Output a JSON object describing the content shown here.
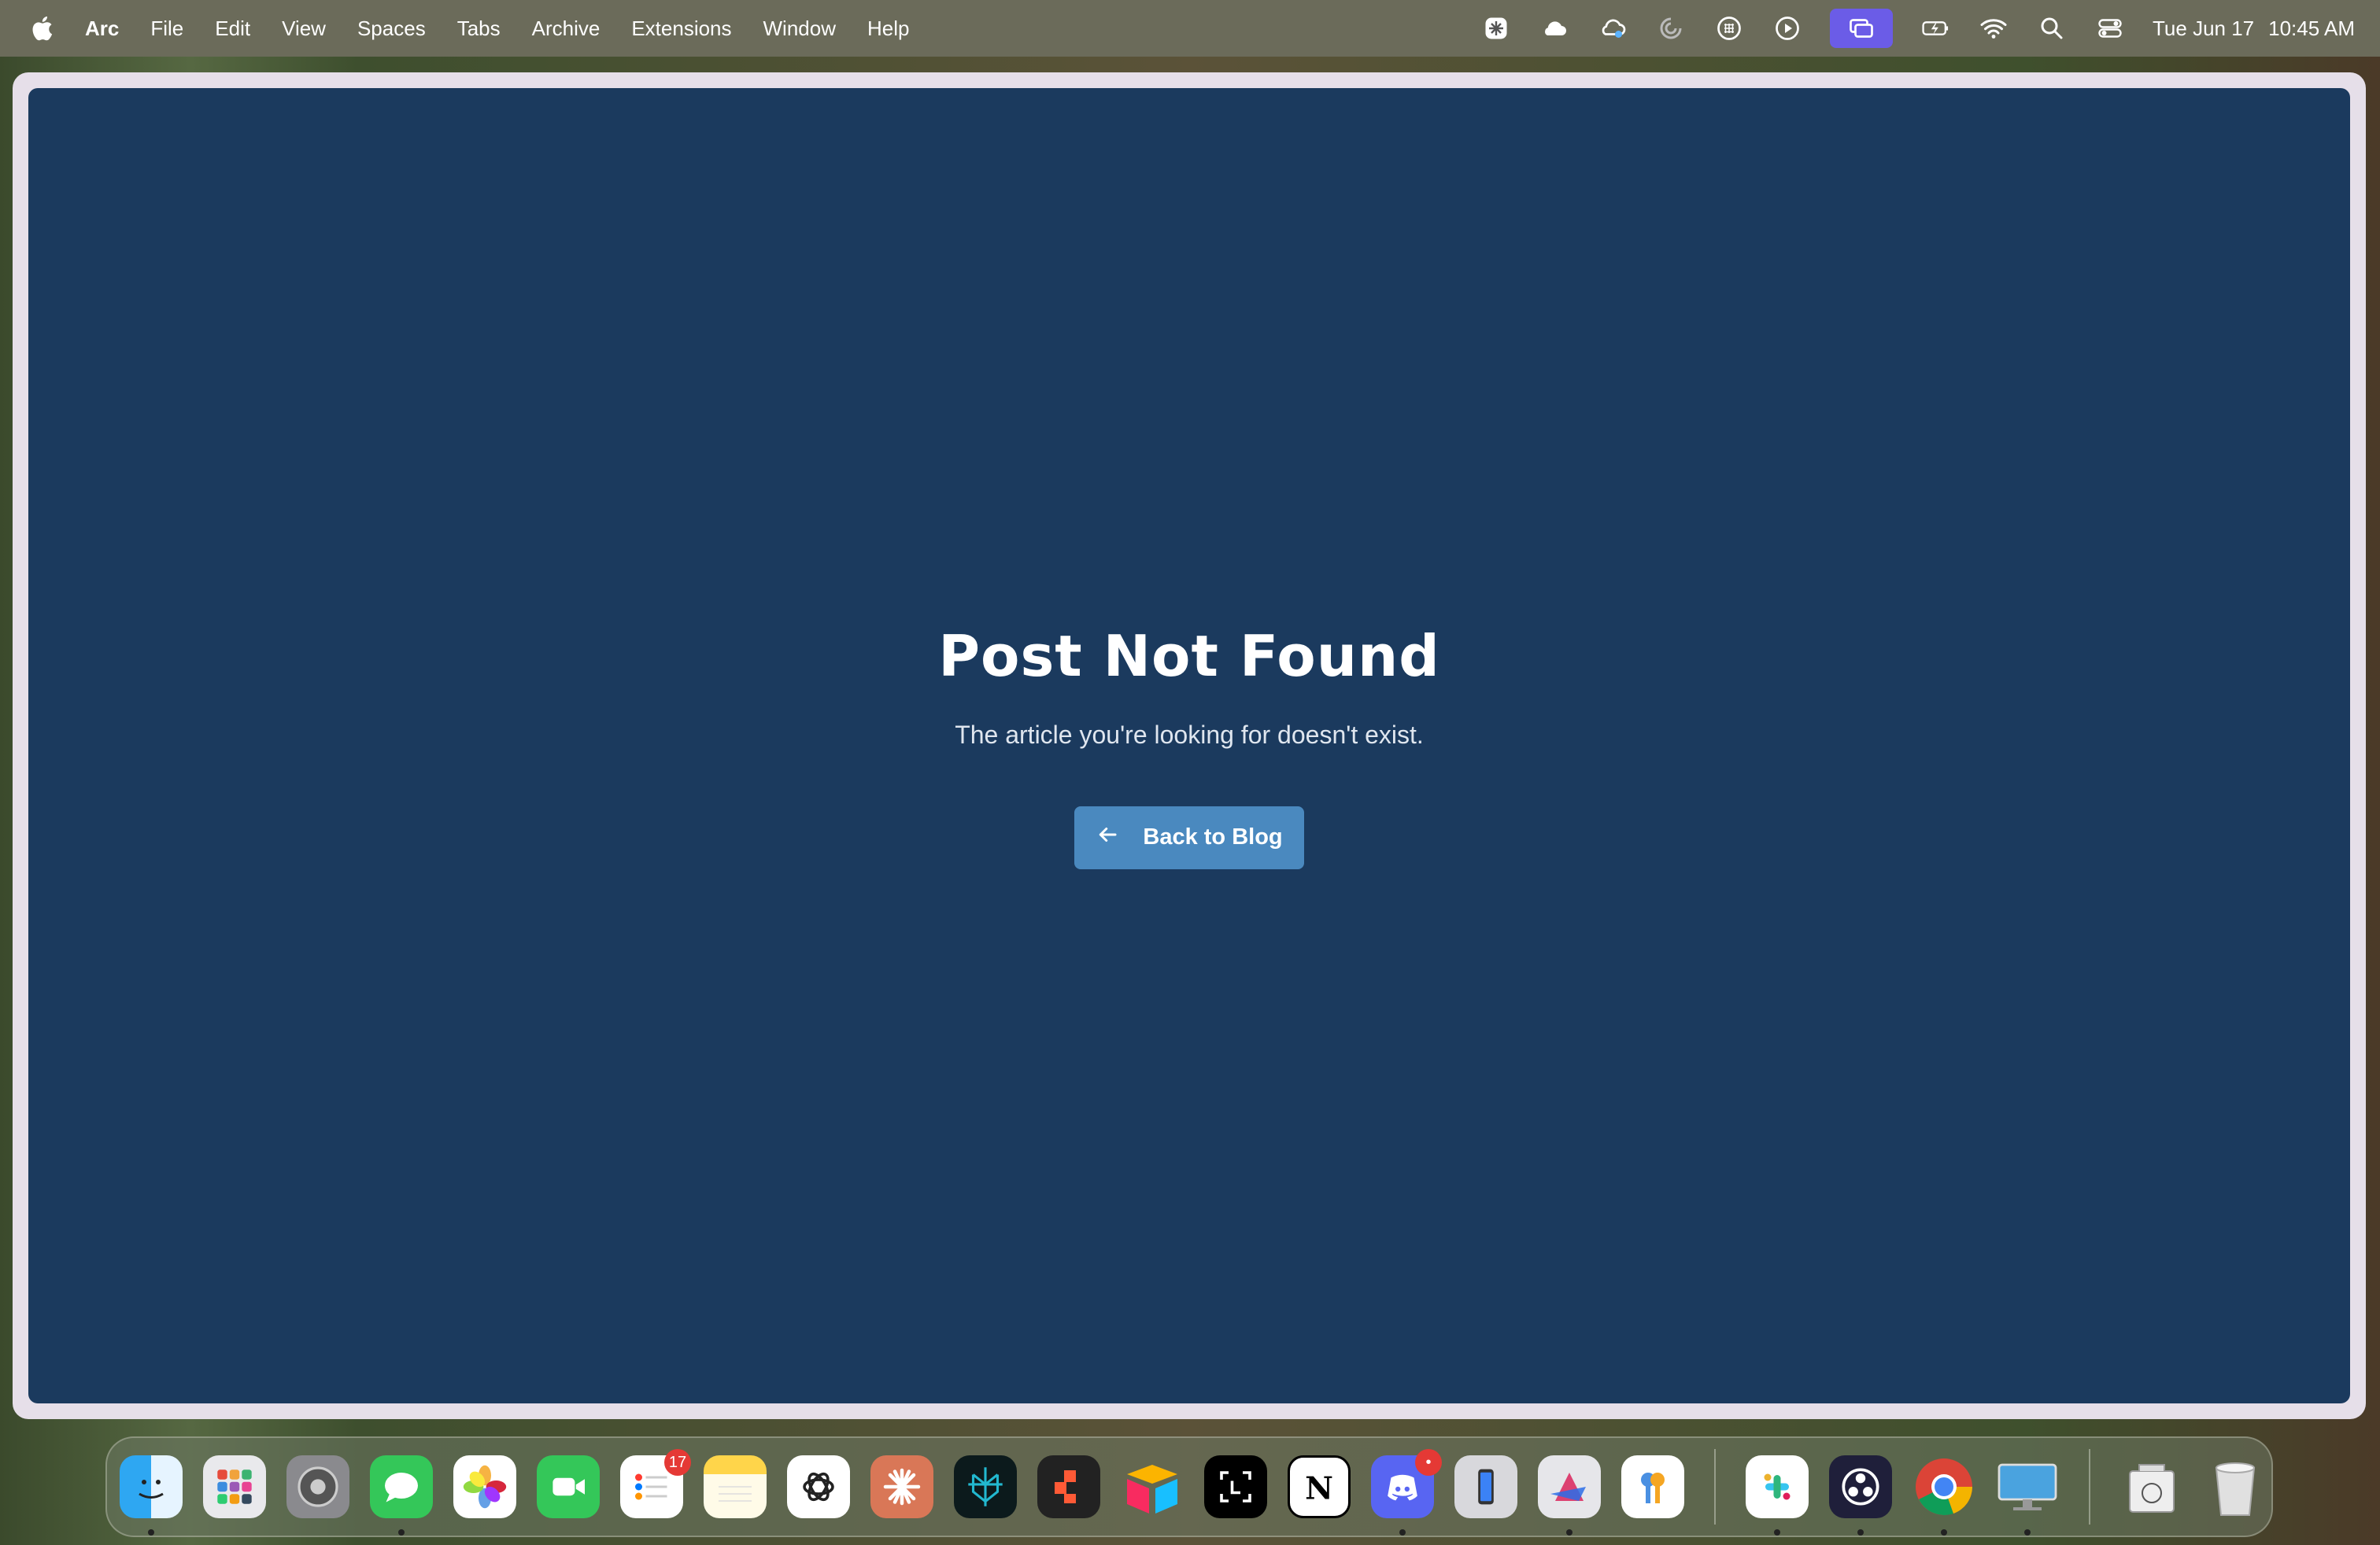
{
  "menubar": {
    "app_name": "Arc",
    "items": [
      "File",
      "Edit",
      "View",
      "Spaces",
      "Tabs",
      "Archive",
      "Extensions",
      "Window",
      "Help"
    ],
    "status_icons": [
      "perplexity-icon",
      "cloud-icon",
      "sync-icon",
      "loading-icon",
      "grid-icon",
      "play-icon",
      "screen-mirror-icon",
      "battery-icon",
      "wifi-icon",
      "search-icon",
      "control-center-icon"
    ],
    "clock": {
      "date": "Tue Jun 17",
      "time": "10:45 AM"
    }
  },
  "page": {
    "title": "Post Not Found",
    "subtitle": "The article you're looking for doesn't exist.",
    "back_button_label": "Back to Blog",
    "background_color": "#1b3a5e",
    "button_color": "#4a89bf"
  },
  "dock": {
    "apps": [
      {
        "name": "finder",
        "running": true
      },
      {
        "name": "launchpad",
        "running": false
      },
      {
        "name": "system-settings",
        "running": false
      },
      {
        "name": "messages",
        "running": true
      },
      {
        "name": "photos",
        "running": false
      },
      {
        "name": "facetime",
        "running": false
      },
      {
        "name": "reminders",
        "running": false,
        "badge": "17"
      },
      {
        "name": "notes",
        "running": false
      },
      {
        "name": "chatgpt",
        "running": false
      },
      {
        "name": "claude",
        "running": false
      },
      {
        "name": "perplexity",
        "running": false
      },
      {
        "name": "rize",
        "running": false
      },
      {
        "name": "airtable",
        "running": false
      },
      {
        "name": "screen-capture",
        "running": false
      },
      {
        "name": "notion",
        "running": false
      },
      {
        "name": "discord",
        "running": true,
        "badge": "•"
      },
      {
        "name": "iphone-mirroring",
        "running": false
      },
      {
        "name": "affinity",
        "running": true
      },
      {
        "name": "passwords",
        "running": false
      },
      {
        "name": "slack",
        "running": true
      },
      {
        "name": "obs",
        "running": true
      },
      {
        "name": "chrome",
        "running": true
      },
      {
        "name": "screen-sharing",
        "running": true
      },
      {
        "name": "archive-utility",
        "running": false
      },
      {
        "name": "trash",
        "running": false
      }
    ]
  }
}
